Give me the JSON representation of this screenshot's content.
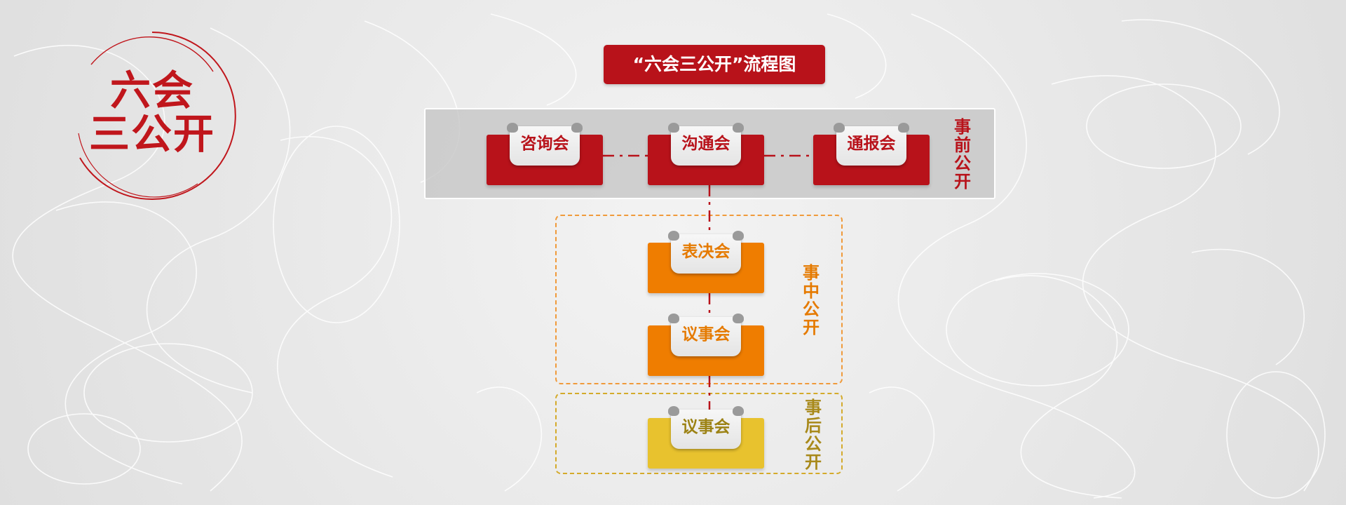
{
  "logo": {
    "line1": "六会",
    "line2": "三公开"
  },
  "title": "“六会三公开”流程图",
  "stages": {
    "before": {
      "label": "事前公开"
    },
    "during": {
      "label": "事中公开"
    },
    "after": {
      "label": "事后公开"
    }
  },
  "nodes": {
    "consult": {
      "label": "咨询会"
    },
    "communicate": {
      "label": "沟通会"
    },
    "report": {
      "label": "通报会"
    },
    "vote": {
      "label": "表决会"
    },
    "deliberate": {
      "label": "议事会"
    },
    "deliberate2": {
      "label": "议事会"
    }
  },
  "colors": {
    "red": "#b8121a",
    "orange": "#ef7d00",
    "yellow": "#e8c22e",
    "gray_panel": "#c3c3c3"
  }
}
